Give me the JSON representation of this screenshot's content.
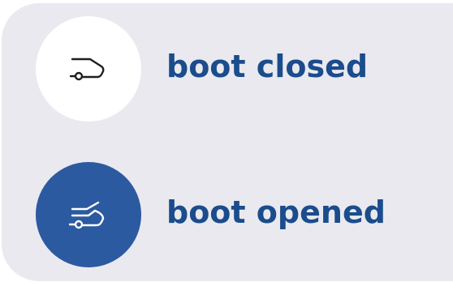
{
  "states": [
    {
      "label": "boot closed",
      "icon": "car-boot-closed-icon",
      "icon_bg": "#ffffff",
      "icon_stroke": "#1f1f1f"
    },
    {
      "label": "boot opened",
      "icon": "car-boot-open-icon",
      "icon_bg": "#2c5aa0",
      "icon_stroke": "#ffffff"
    }
  ],
  "colors": {
    "label_text": "#1b4c8c",
    "panel_bg": "#e9e9ef"
  }
}
